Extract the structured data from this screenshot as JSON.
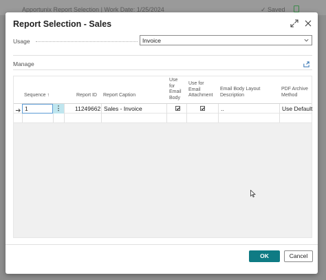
{
  "background": {
    "title": "Apportunix Report Selection | Work Date: 1/25/2024",
    "saved": "✓ Saved"
  },
  "dialog": {
    "title": "Report Selection - Sales",
    "usage_label": "Usage",
    "usage_value": "Invoice",
    "manage_label": "Manage"
  },
  "table": {
    "headers": {
      "sequence": "Sequence ↑",
      "report_id": "Report ID",
      "report_caption": "Report Caption",
      "use_email_body": "Use for Email Body",
      "use_email_attachment": "Use for Email Attachment",
      "email_body_layout": "Email Body Layout Description",
      "pdf_archive": "PDF Archive Method"
    },
    "rows": [
      {
        "sequence": "1",
        "report_id": "11249662",
        "report_caption": "Sales - Invoice",
        "use_email_body": true,
        "use_email_attachment": true,
        "email_body_layout": "..",
        "pdf_archive": "Use Default"
      }
    ]
  },
  "buttons": {
    "ok": "OK",
    "cancel": "Cancel"
  },
  "colors": {
    "accent": "#0f7b84",
    "row_action": "#bfe6ef"
  }
}
